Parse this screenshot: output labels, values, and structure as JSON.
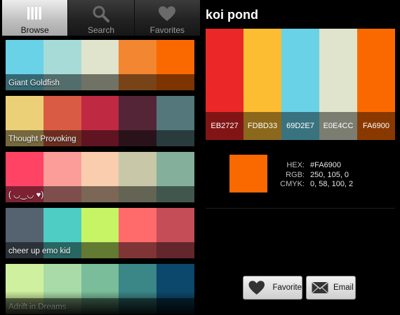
{
  "tabs": [
    {
      "label": "Browse",
      "icon": "browse-icon",
      "active": true
    },
    {
      "label": "Search",
      "icon": "search-icon",
      "active": false
    },
    {
      "label": "Favorites",
      "icon": "heart-icon",
      "active": false
    }
  ],
  "palettes": [
    {
      "name": "Giant Goldfish",
      "colors": [
        "#69D2E7",
        "#A7DBD8",
        "#E0E4CC",
        "#F38630",
        "#FA6900"
      ]
    },
    {
      "name": "Thought Provoking",
      "colors": [
        "#ECD078",
        "#D95B43",
        "#C02942",
        "#542437",
        "#53777A"
      ]
    },
    {
      "name": "( ◡‿◡ ♥)",
      "colors": [
        "#FE4365",
        "#FC9D9A",
        "#F9CDAD",
        "#C8C8A9",
        "#83AF9B"
      ]
    },
    {
      "name": "cheer up emo kid",
      "colors": [
        "#556270",
        "#4ECDC4",
        "#C7F464",
        "#FF6B6B",
        "#C44D58"
      ]
    },
    {
      "name": "Adrift in Dreams",
      "colors": [
        "#CFF09E",
        "#A8DBA8",
        "#79BD9A",
        "#3B8686",
        "#0B486B"
      ]
    }
  ],
  "detail": {
    "title": "koi pond",
    "colors": [
      {
        "hex": "EB2727",
        "color": "#EB2727"
      },
      {
        "hex": "FDBD33",
        "color": "#FDBD33"
      },
      {
        "hex": "69D2E7",
        "color": "#69D2E7"
      },
      {
        "hex": "E0E4CC",
        "color": "#E0E4CC"
      },
      {
        "hex": "FA6900",
        "color": "#FA6900"
      }
    ],
    "selected": {
      "color": "#FA6900",
      "hex_label": "HEX:",
      "hex_value": "#FA6900",
      "rgb_label": "RGB:",
      "rgb_value": "250, 105, 0",
      "cmyk_label": "CMYK:",
      "cmyk_value": "0, 58, 100, 2"
    }
  },
  "actions": {
    "favorite_label": "Favorite",
    "email_label": "Email"
  }
}
